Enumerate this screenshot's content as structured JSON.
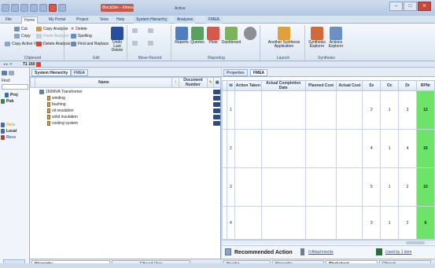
{
  "window": {
    "app_badge": "BlockSim - Xfmea",
    "context_label": "Active"
  },
  "ribbon_tabs": [
    "File",
    "Home",
    "My Portal",
    "Project",
    "View",
    "Help",
    "System Hierarchy",
    "Analyses",
    "FMEA"
  ],
  "ribbon": {
    "clipboard": {
      "label": "Clipboard",
      "cut": "Cut",
      "copy": "Copy",
      "copy_active": "Copy Active View",
      "copy_analysis": "Copy Analysis",
      "paste_analysis": "Paste Analysis",
      "delete_analysis": "Delete Analysis"
    },
    "edit": {
      "label": "Edit",
      "delete": "Delete",
      "spelling": "Spelling",
      "find_replace": "Find and Replace",
      "undo": "Undo Last Delete"
    },
    "move": {
      "label": "Move Record"
    },
    "reporting": {
      "label": "Reporting",
      "reports": "Reports",
      "queries": "Queries",
      "plots": "Plots",
      "dashboard": "Dashboard"
    },
    "launch": {
      "label": "Launch",
      "another_synthesis": "Another Synthesis Application"
    },
    "synthesis": {
      "label": "Synthesis",
      "explorer": "Synthesis Explorer",
      "actions": "Actions Explorer"
    }
  },
  "doc_tab": "T1 160",
  "left_strip": {
    "find_label": "Find:",
    "items": [
      "Proj",
      "Pub",
      "Relia",
      "Local",
      "Reco"
    ]
  },
  "main": {
    "tabs": [
      "System Hierarchy",
      "FMEA"
    ],
    "columns": {
      "name": "Name",
      "document": "Document Number"
    },
    "rows": [
      "160MVA Transformer",
      "winding",
      "bushing",
      "oil insulation",
      "solid insulation",
      "cooling system"
    ],
    "bottom_tabs": [
      "Hierarchy",
      "Filtered View"
    ]
  },
  "right": {
    "tabs": [
      "Properties",
      "FMEA"
    ],
    "columns": [
      "Id",
      "Action Taken",
      "Actual Completion Date",
      "Planned Cost",
      "Actual Cost",
      "Sv",
      "Oc",
      "Dr",
      "RPNr"
    ],
    "rows": [
      {
        "id": "1",
        "sv": "2",
        "oc": "1",
        "dr": "3",
        "rpn": "12"
      },
      {
        "id": "2",
        "sv": "4",
        "oc": "1",
        "dr": "4",
        "rpn": "16"
      },
      {
        "id": "3",
        "sv": "5",
        "oc": "1",
        "dr": "2",
        "rpn": "10"
      },
      {
        "id": "4",
        "sv": "3",
        "oc": "1",
        "dr": "2",
        "rpn": "6"
      }
    ],
    "recommended_action": "Recommended Action",
    "attachments": "0 Attachments",
    "used_by": "Used by 1 item",
    "bottom_tabs": [
      "Header",
      "Hierarchy",
      "Worksheet",
      "Filtered"
    ]
  },
  "colors": {
    "rpn_green": "#6ee36a",
    "ribbon_bg": "#dae5f3"
  }
}
